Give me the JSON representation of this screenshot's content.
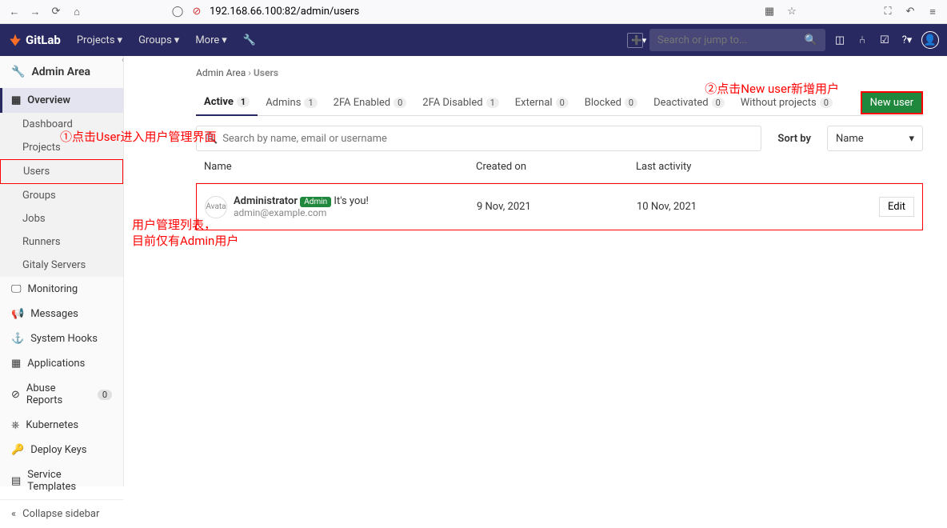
{
  "browser": {
    "url": "192.168.66.100:82/admin/users"
  },
  "nav": {
    "brand": "GitLab",
    "projects": "Projects",
    "groups": "Groups",
    "more": "More",
    "search_ph": "Search or jump to..."
  },
  "sidebar": {
    "header": "Admin Area",
    "items": [
      "Overview",
      "Dashboard",
      "Projects",
      "Users",
      "Groups",
      "Jobs",
      "Runners",
      "Gitaly Servers",
      "Monitoring",
      "Messages",
      "System Hooks",
      "Applications",
      "Abuse Reports",
      "Kubernetes",
      "Deploy Keys",
      "Service Templates"
    ],
    "abuse_count": "0",
    "collapse": "Collapse sidebar"
  },
  "crumb": {
    "a": "Admin Area",
    "b": "Users"
  },
  "tabs": [
    {
      "label": "Active",
      "n": "1"
    },
    {
      "label": "Admins",
      "n": "1"
    },
    {
      "label": "2FA Enabled",
      "n": "0"
    },
    {
      "label": "2FA Disabled",
      "n": "1"
    },
    {
      "label": "External",
      "n": "0"
    },
    {
      "label": "Blocked",
      "n": "0"
    },
    {
      "label": "Deactivated",
      "n": "0"
    },
    {
      "label": "Without projects",
      "n": "0"
    }
  ],
  "new_user": "New user",
  "search_ph": "Search by name, email or username",
  "sort_by": "Sort by",
  "sort_val": "Name",
  "cols": {
    "name": "Name",
    "created": "Created on",
    "activity": "Last activity"
  },
  "row": {
    "avatar": "Avata",
    "name": "Administrator",
    "badge": "Admin",
    "you": "It's you!",
    "email": "admin@example.com",
    "created": "9 Nov, 2021",
    "activity": "10 Nov, 2021",
    "edit": "Edit"
  },
  "anno": {
    "a1": "①点击User进入用户管理界面",
    "a2": "②点击New user新增用户",
    "a3": "用户管理列表，",
    "a4": "目前仅有Admin用户"
  }
}
